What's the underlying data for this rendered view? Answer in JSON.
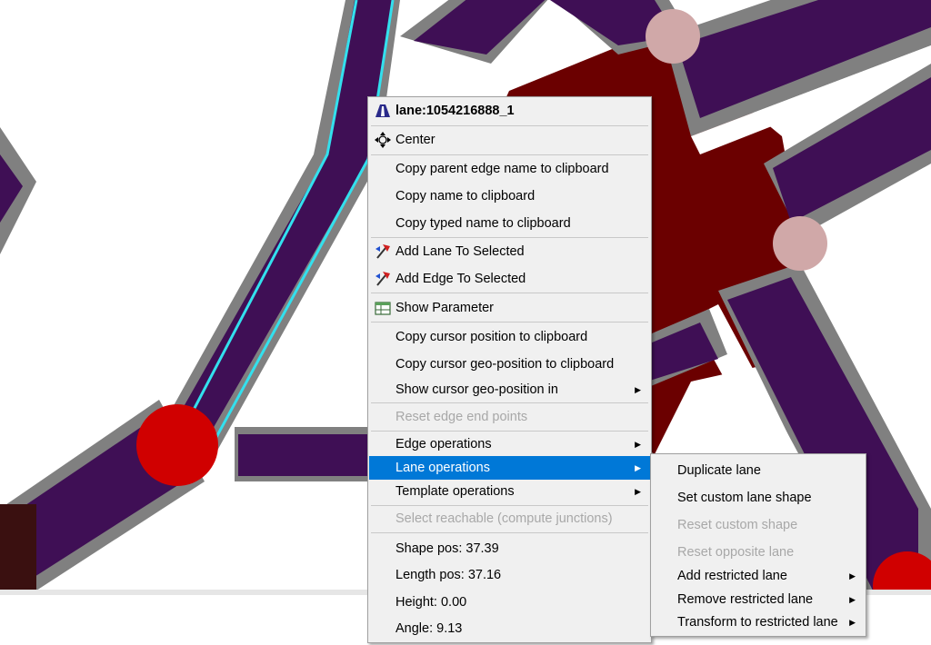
{
  "context_menu": {
    "title": "lane:1054216888_1",
    "center": "Center",
    "copy_parent_edge_name": "Copy parent edge name to clipboard",
    "copy_name": "Copy name to clipboard",
    "copy_typed_name": "Copy typed name to clipboard",
    "add_lane_to_selected": "Add Lane To Selected",
    "add_edge_to_selected": "Add Edge To Selected",
    "show_parameter": "Show Parameter",
    "copy_cursor_position": "Copy cursor position to clipboard",
    "copy_cursor_geo_position": "Copy cursor geo-position to clipboard",
    "show_cursor_geo_position": "Show cursor geo-position in",
    "reset_edge_end_points": "Reset edge end points",
    "edge_operations": "Edge operations",
    "lane_operations": "Lane operations",
    "template_operations": "Template operations",
    "select_reachable": "Select reachable (compute junctions)",
    "shape_pos": "Shape pos: 37.39",
    "length_pos": "Length pos: 37.16",
    "height": "Height: 0.00",
    "angle": "Angle: 9.13"
  },
  "lane_operations_submenu": {
    "duplicate_lane": "Duplicate lane",
    "set_custom_lane_shape": "Set custom lane shape",
    "reset_custom_shape": "Reset custom shape",
    "reset_opposite_lane": "Reset opposite lane",
    "add_restricted_lane": "Add restricted lane",
    "remove_restricted_lane": "Remove restricted lane",
    "transform_to_restricted_lane": "Transform to restricted lane"
  },
  "colors": {
    "lane": "#3f0f55",
    "sidewalk": "#808080",
    "junction": "#6b0000",
    "junction_red": "#d00000",
    "selection_outline": "#33e0ee",
    "menu_bg": "#f0f0f0",
    "highlight": "#0078d7"
  }
}
